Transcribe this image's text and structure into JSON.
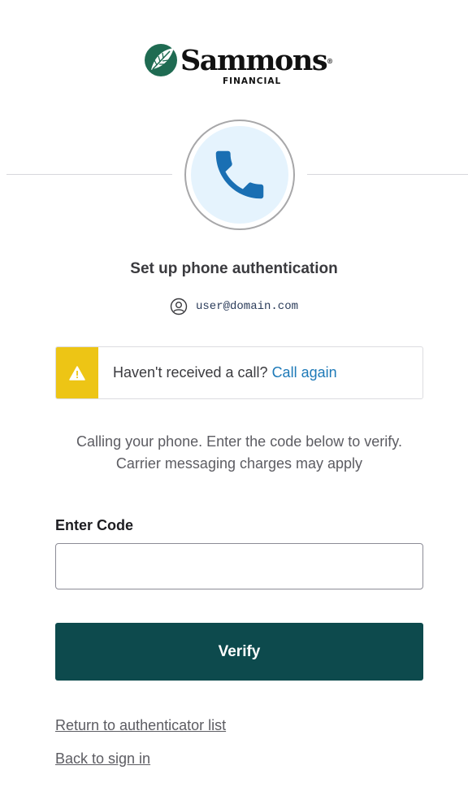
{
  "logo": {
    "wordmark": "Sammons",
    "trademark": "®",
    "subtitle": "FINANCIAL",
    "brand_color": "#1f6b52"
  },
  "factor": {
    "icon": "phone-icon",
    "icon_color": "#1a6fb3",
    "circle_fill": "#e5f3fd"
  },
  "title": "Set up phone authentication",
  "identifier": {
    "icon": "user-circle-icon",
    "value": "user@domain.com"
  },
  "callout": {
    "icon": "warning-icon",
    "accent": "#edc515",
    "message": "Haven't received a call?",
    "link_label": "Call again"
  },
  "instructions": {
    "line1": "Calling your phone. Enter the code below to verify.",
    "line2": "Carrier messaging charges may apply"
  },
  "code_field": {
    "label": "Enter Code",
    "value": "",
    "placeholder": ""
  },
  "verify_button": {
    "label": "Verify",
    "color": "#0d4a4d"
  },
  "links": {
    "return_label": "Return to authenticator list",
    "back_label": "Back to sign in"
  }
}
